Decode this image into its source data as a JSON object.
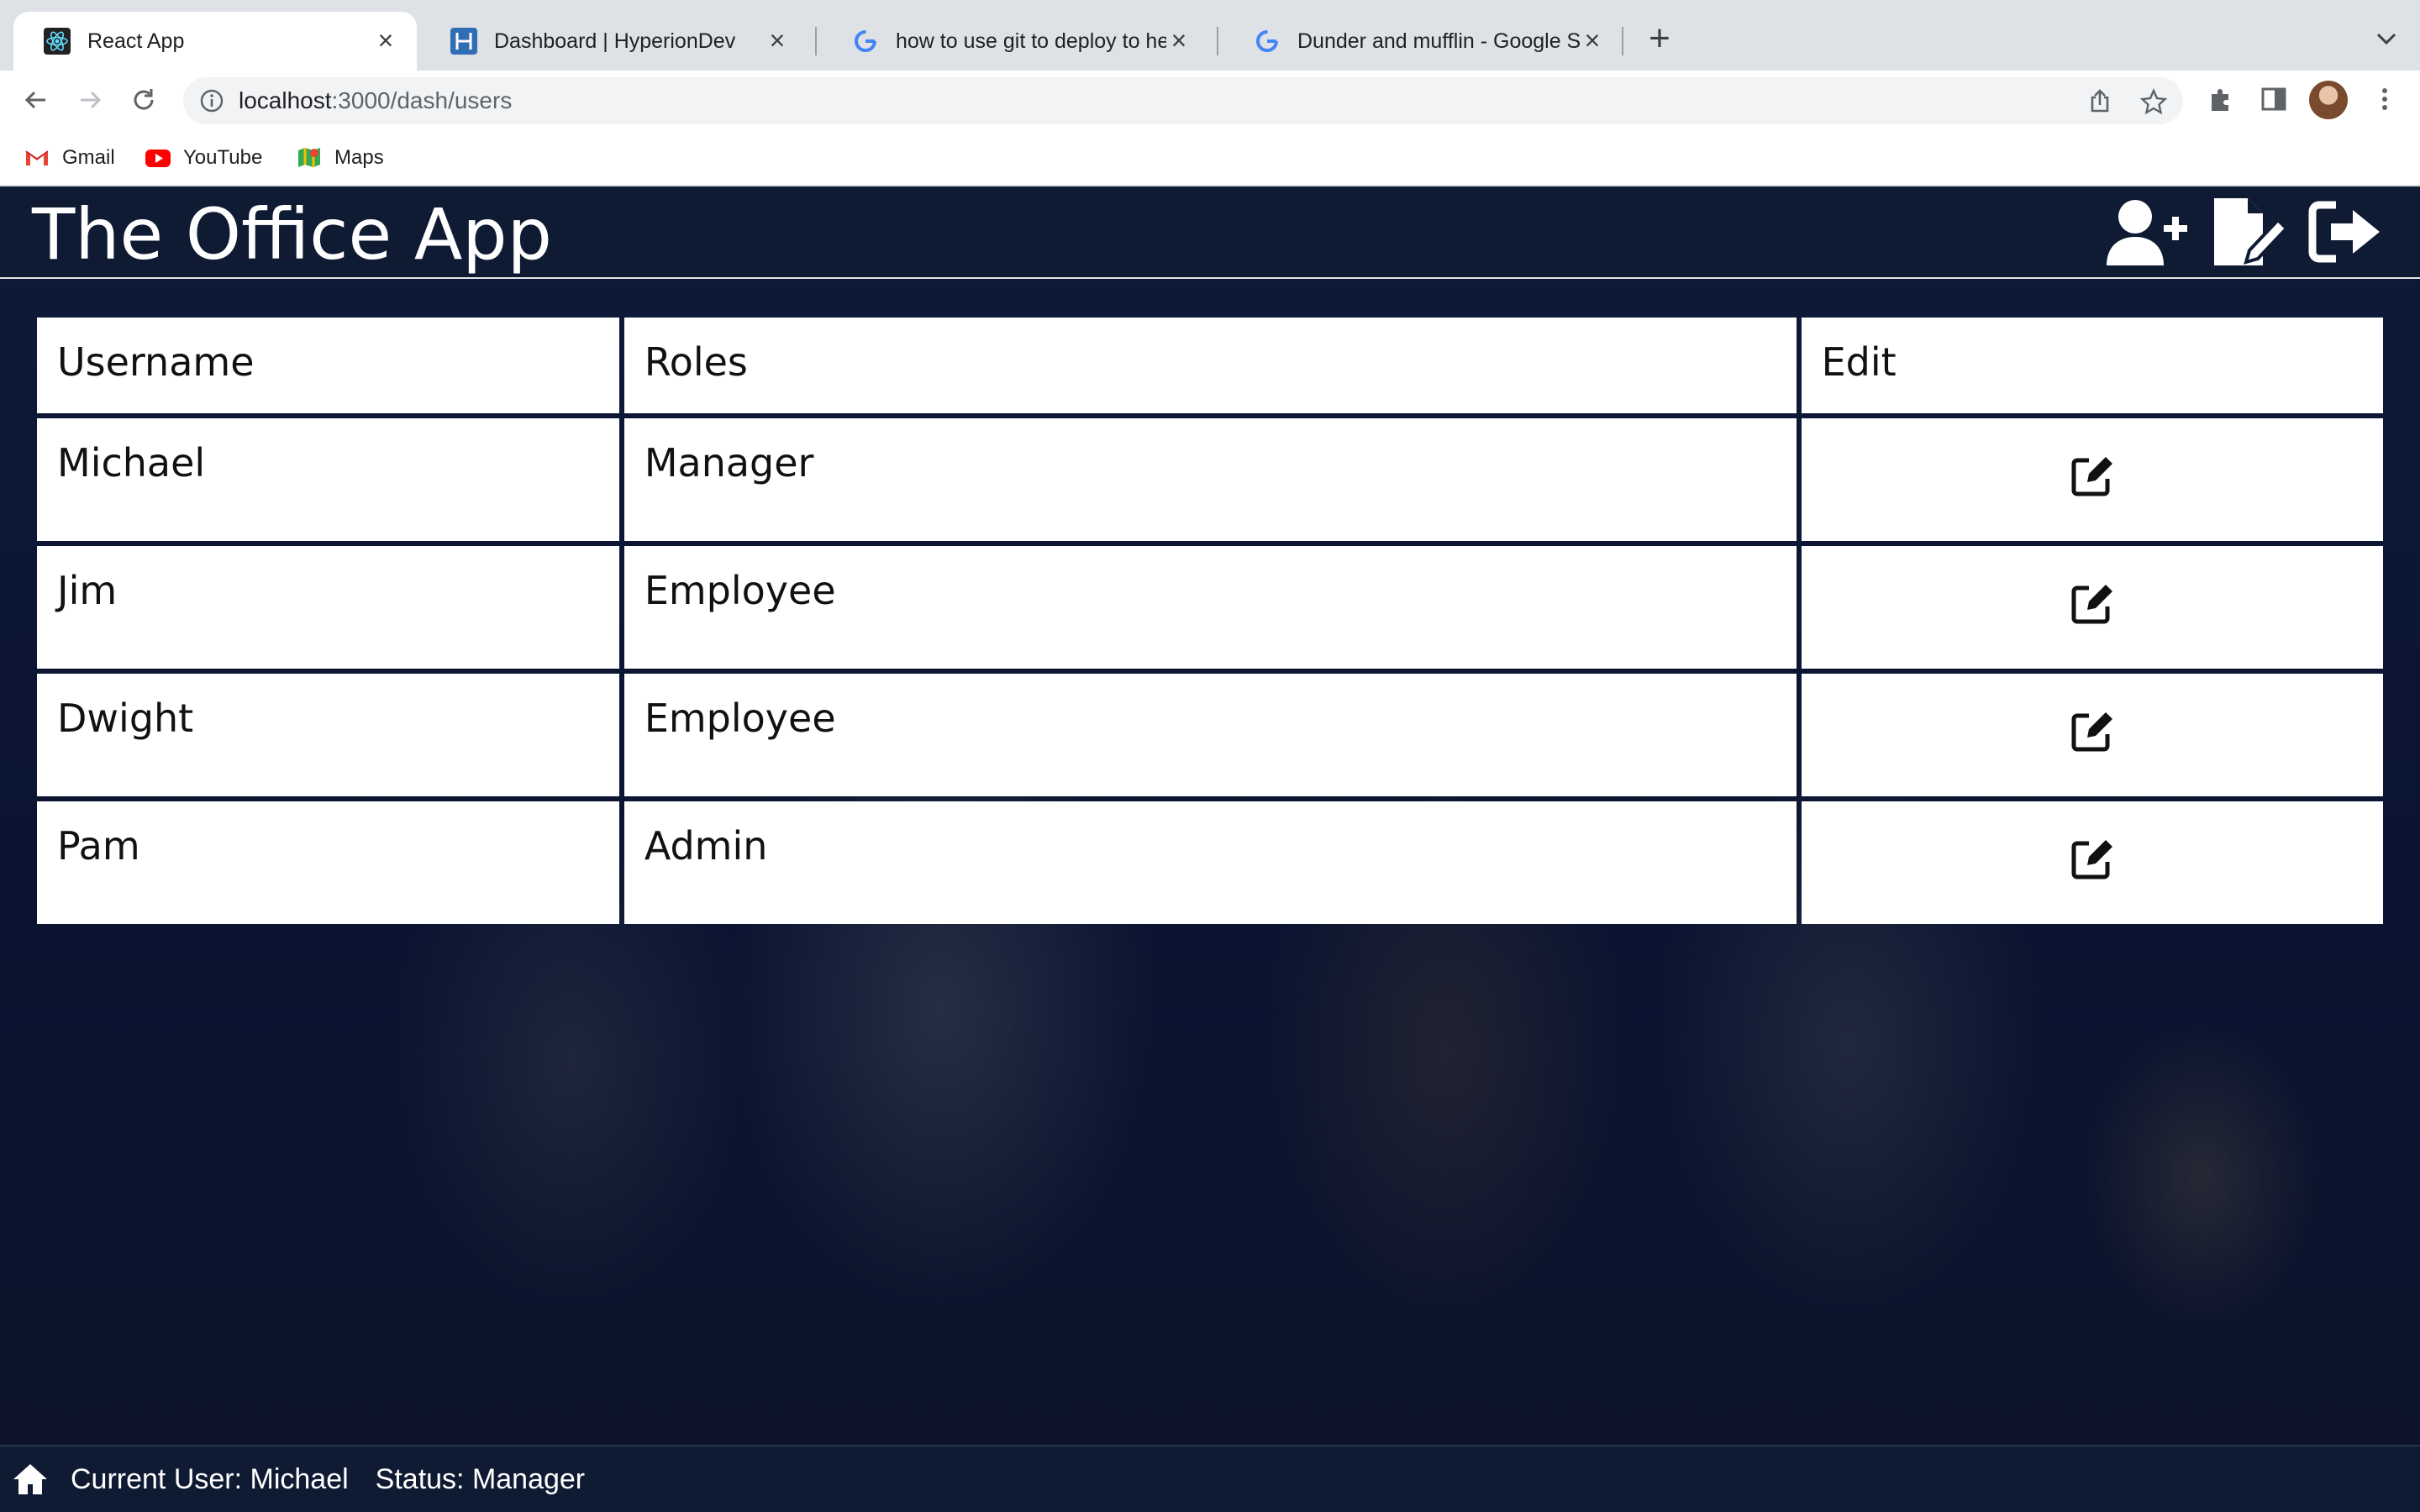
{
  "browser": {
    "tabs": [
      {
        "title": "React App",
        "active": true,
        "favicon": "react-icon"
      },
      {
        "title": "Dashboard | HyperionDev",
        "active": false,
        "favicon": "hyperiondev-icon"
      },
      {
        "title": "how to use git to deploy to her",
        "active": false,
        "favicon": "google-icon"
      },
      {
        "title": "Dunder and mufflin - Google Se",
        "active": false,
        "favicon": "google-icon"
      }
    ],
    "url_host": "localhost",
    "url_path": ":3000/dash/users",
    "bookmarks": [
      {
        "label": "Gmail",
        "icon": "gmail-icon"
      },
      {
        "label": "YouTube",
        "icon": "youtube-icon"
      },
      {
        "label": "Maps",
        "icon": "maps-icon"
      }
    ]
  },
  "app": {
    "title": "The Office App",
    "header_buttons": [
      "add-user-icon",
      "new-note-icon",
      "logout-icon"
    ],
    "table": {
      "headers": [
        "Username",
        "Roles",
        "Edit"
      ],
      "rows": [
        {
          "username": "Michael",
          "roles": "Manager"
        },
        {
          "username": "Jim",
          "roles": "Employee"
        },
        {
          "username": "Dwight",
          "roles": "Employee"
        },
        {
          "username": "Pam",
          "roles": "Admin"
        }
      ]
    },
    "footer": {
      "current_user": "Current User: Michael",
      "status": "Status: Manager"
    }
  },
  "colors": {
    "header_bg": "#0f1a33",
    "chrome_tabstrip": "#dee1e6",
    "omnibox": "#f1f3f4"
  }
}
